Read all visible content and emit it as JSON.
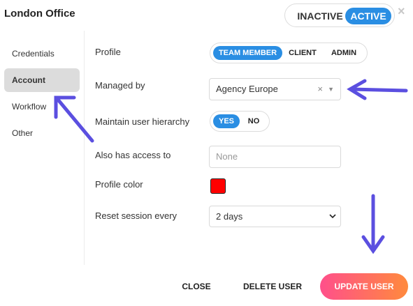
{
  "header": {
    "title": "London Office",
    "status": {
      "inactive_label": "INACTIVE",
      "active_label": "ACTIVE",
      "selected": "ACTIVE"
    },
    "close_icon": "×"
  },
  "sidebar": {
    "items": [
      {
        "label": "Credentials",
        "selected": false
      },
      {
        "label": "Account",
        "selected": true
      },
      {
        "label": "Workflow",
        "selected": false
      },
      {
        "label": "Other",
        "selected": false
      }
    ]
  },
  "form": {
    "profile": {
      "label": "Profile",
      "options": [
        "TEAM MEMBER",
        "CLIENT",
        "ADMIN"
      ],
      "selected": "TEAM MEMBER"
    },
    "managed_by": {
      "label": "Managed by",
      "value": "Agency Europe",
      "clear_icon": "×",
      "caret_icon": "▼"
    },
    "hierarchy": {
      "label": "Maintain user hierarchy",
      "options": [
        "YES",
        "NO"
      ],
      "selected": "YES"
    },
    "access": {
      "label": "Also has access to",
      "placeholder": "None"
    },
    "color": {
      "label": "Profile color",
      "value": "#ff0000"
    },
    "session": {
      "label": "Reset session every",
      "value": "2 days"
    }
  },
  "footer": {
    "close_label": "CLOSE",
    "delete_label": "DELETE USER",
    "update_label": "UPDATE USER"
  },
  "annotations": {
    "arrow_color": "#5b4fe0"
  }
}
